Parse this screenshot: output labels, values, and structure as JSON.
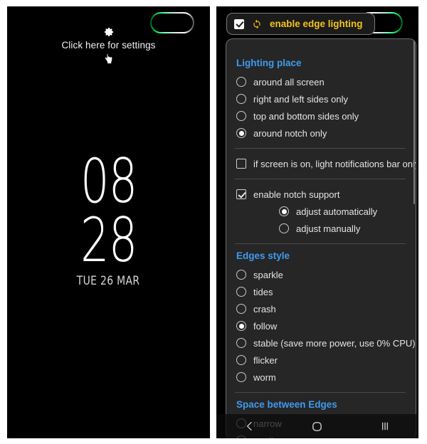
{
  "left_phone": {
    "notch": {
      "icon": "edge-lighting-notch-ring"
    },
    "hint": {
      "gear_icon": "gear-icon",
      "text": "Click here for settings",
      "hand_icon": "pointing-hand-icon"
    },
    "lockscreen": {
      "hour": "08",
      "minute": "28",
      "date": "TUE 26 MAR"
    }
  },
  "right_phone": {
    "notch": {
      "icon": "edge-lighting-notch-ring"
    },
    "header": {
      "checkbox_checked": true,
      "sync_icon": "sync-icon",
      "label": "enable edge lighting",
      "accent": "#f0c419"
    },
    "sections": [
      {
        "title": "Lighting place",
        "accent": "#3e9bf0",
        "options": [
          {
            "type": "radio",
            "label": "around all screen",
            "selected": false
          },
          {
            "type": "radio",
            "label": "right and left sides only",
            "selected": false
          },
          {
            "type": "radio",
            "label": "top and bottom sides only",
            "selected": false
          },
          {
            "type": "radio",
            "label": "around notch only",
            "selected": true
          }
        ]
      },
      {
        "title": "",
        "options": [
          {
            "type": "checkbox",
            "label": "if screen is on, light notifications bar only",
            "selected": false
          }
        ]
      },
      {
        "title": "",
        "options": [
          {
            "type": "checkbox",
            "label": "enable notch support",
            "selected": true
          },
          {
            "type": "radio",
            "label": "adjust automatically",
            "selected": true,
            "indent": true
          },
          {
            "type": "radio",
            "label": "adjust manually",
            "selected": false,
            "indent": true
          }
        ]
      },
      {
        "title": "Edges style",
        "accent": "#3e9bf0",
        "options": [
          {
            "type": "radio",
            "label": "sparkle",
            "selected": false
          },
          {
            "type": "radio",
            "label": "tides",
            "selected": false
          },
          {
            "type": "radio",
            "label": "crash",
            "selected": false
          },
          {
            "type": "radio",
            "label": "follow",
            "selected": true
          },
          {
            "type": "radio",
            "label": "stable (save more power, use 0% CPU)",
            "selected": false
          },
          {
            "type": "radio",
            "label": "flicker",
            "selected": false
          },
          {
            "type": "radio",
            "label": "worm",
            "selected": false
          }
        ]
      },
      {
        "title": "Space between Edges",
        "accent": "#3e9bf0",
        "options": [
          {
            "type": "radio",
            "label": "narrow",
            "selected": false
          },
          {
            "type": "radio",
            "label": "medium",
            "selected": true
          }
        ]
      }
    ],
    "navbar": {
      "back": "back-icon",
      "home": "home-icon",
      "recents": "recents-icon"
    }
  }
}
